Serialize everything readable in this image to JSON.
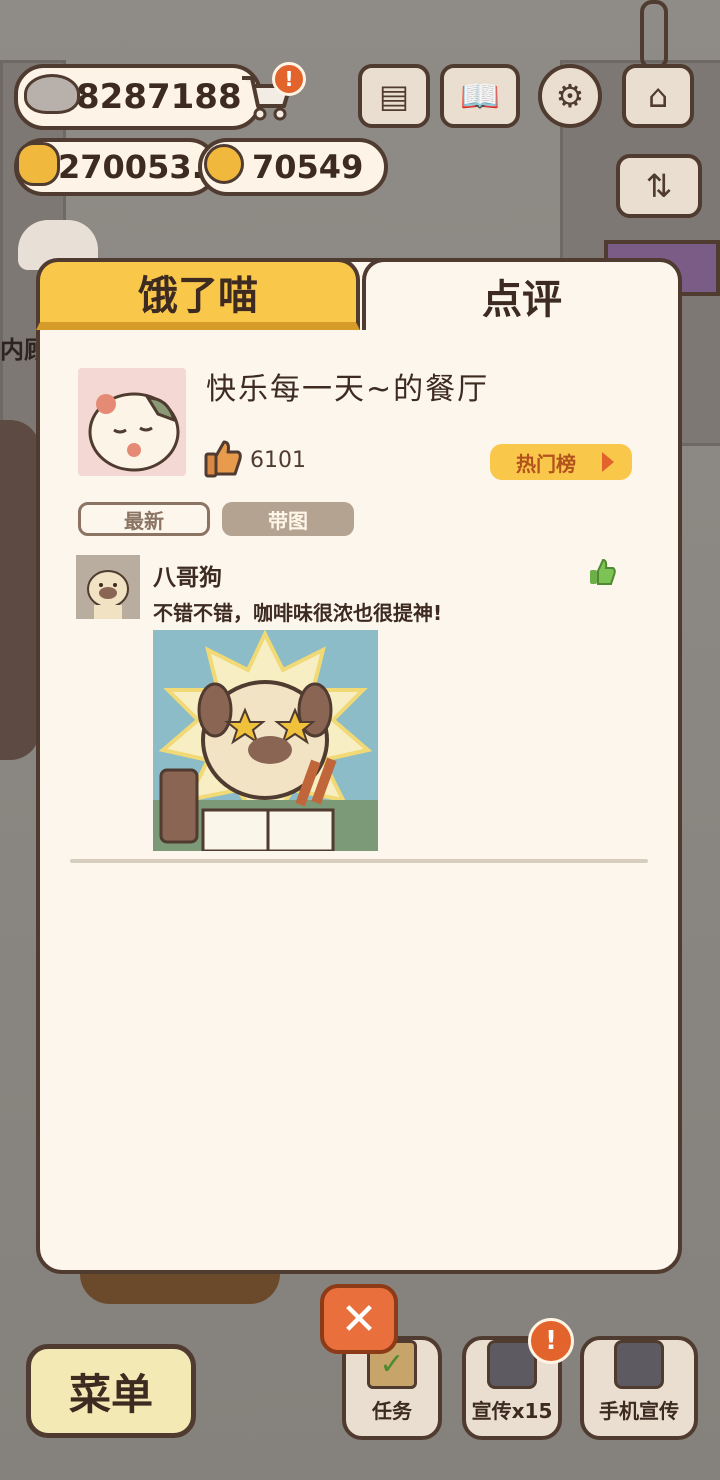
{
  "currency": {
    "fish": "8287188",
    "star": "270053.",
    "bell": "70549"
  },
  "icons": {
    "fish": "fish-icon",
    "cart": "cart-icon",
    "star": "star-icon",
    "bell": "bell-icon",
    "news": "newspaper-icon",
    "book": "book-icon",
    "settings": "gear-icon",
    "shop": "shop-icon",
    "sort": "sort-icon"
  },
  "badges": {
    "cart": "!",
    "promo": "!"
  },
  "tabs": {
    "left": "饿了喵",
    "right": "点评"
  },
  "restaurant": {
    "name": "快乐每一天~的餐厅",
    "likes": "6101",
    "hot_label": "热门榜"
  },
  "filters": {
    "newest": "最新",
    "with_image": "带图"
  },
  "review": {
    "name": "八哥狗",
    "text": "不错不错，咖啡味很浓也很提神!"
  },
  "bottom": {
    "menu": "菜单",
    "close": "✕",
    "tasks": "任务",
    "promo": "宣传x15",
    "phone_promo": "手机宣传"
  },
  "background_text": "内顾",
  "colors": {
    "accent_yellow": "#f9c84b",
    "panel_bg": "#fcf6ec",
    "outline_brown": "#4f3b2f",
    "close_orange": "#e9703d",
    "like_green": "#6db04a"
  }
}
